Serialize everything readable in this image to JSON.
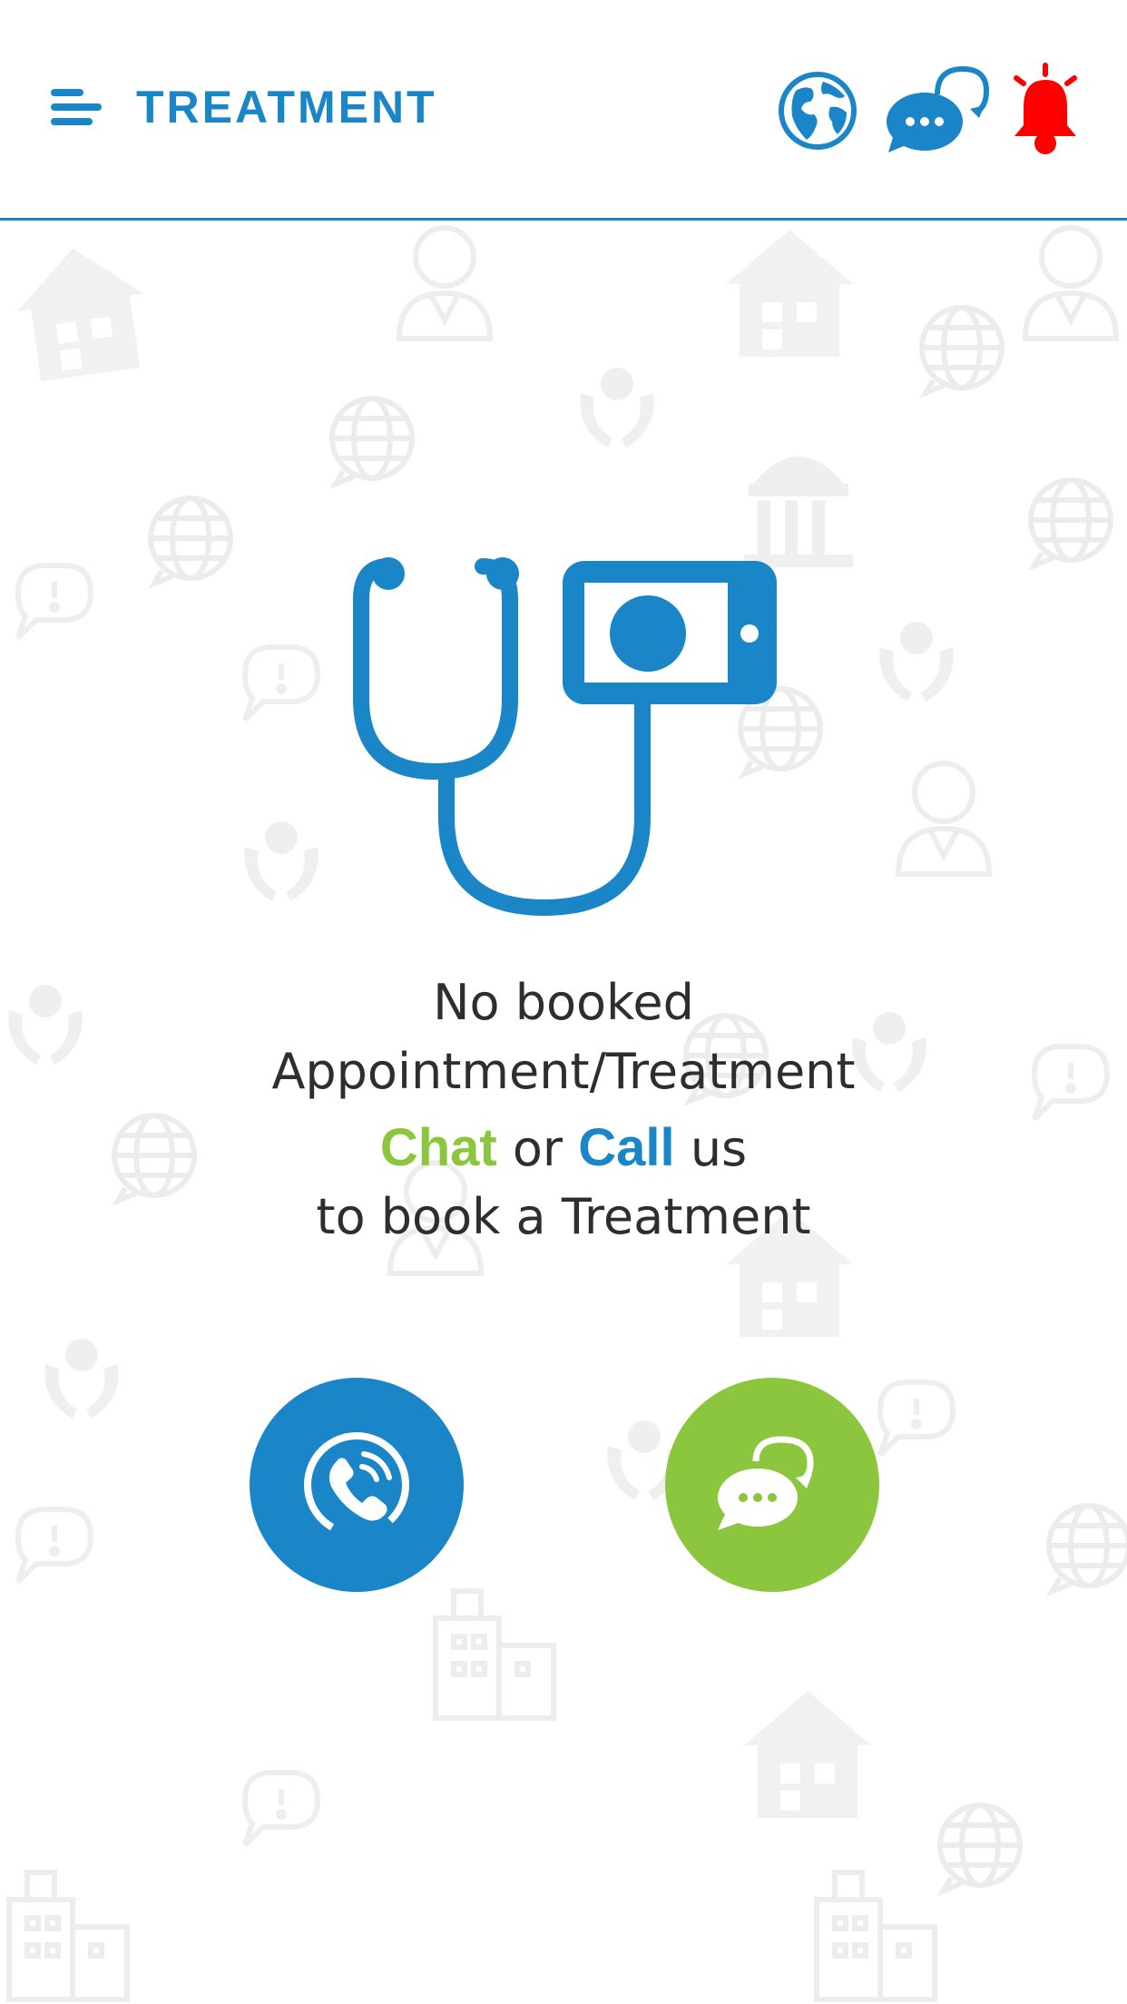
{
  "header": {
    "title": "TREATMENT",
    "menu_icon": "hamburger-menu-icon",
    "icons": [
      "globe-icon",
      "chat-bubbles-icon",
      "bell-icon"
    ]
  },
  "message": {
    "line1": "No booked",
    "line2": "Appointment/Treatment",
    "chat_word": "Chat",
    "or_word": " or ",
    "call_word": "Call",
    "us_word": " us",
    "line4": "to book a Treatment"
  },
  "actions": {
    "call_icon": "phone-call-icon",
    "chat_icon": "chat-bubbles-icon"
  },
  "colors": {
    "primary_blue": "#1a86c8",
    "accent_green": "#8cc63f",
    "alert_red": "#ff0000",
    "pattern_gray": "#f0f0f0"
  }
}
